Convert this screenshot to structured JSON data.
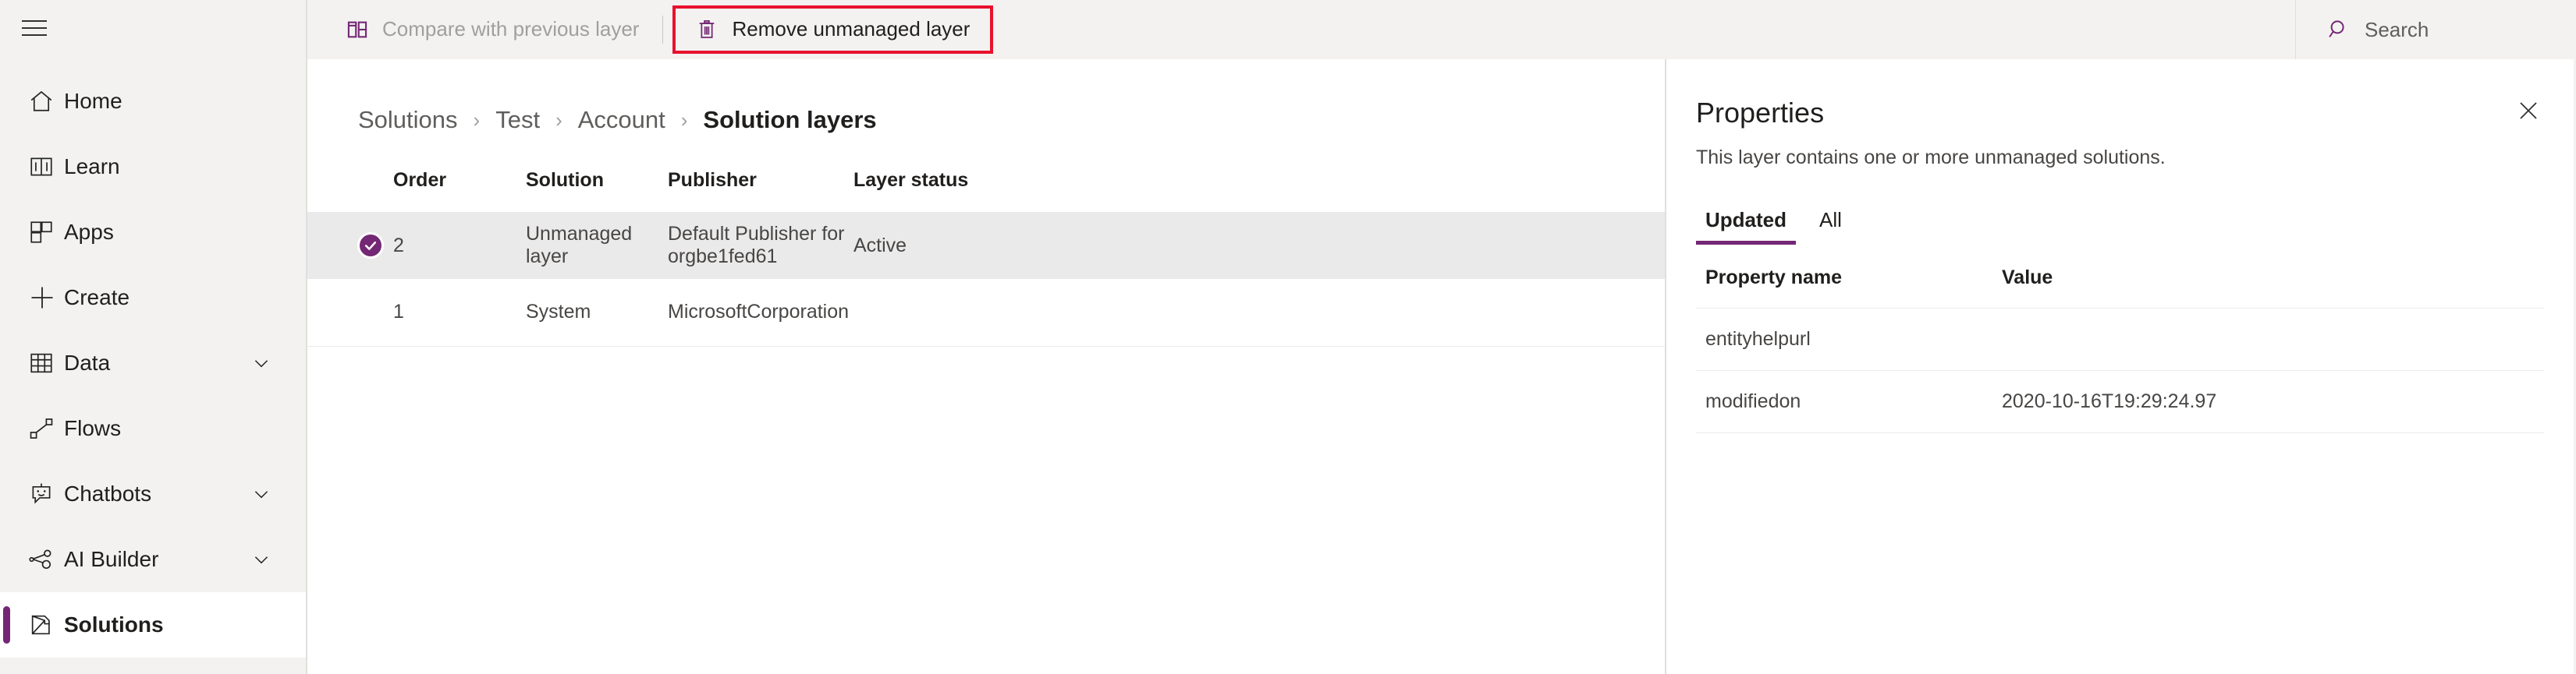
{
  "sidebar": {
    "menu_icon": "hamburger-icon",
    "items": [
      {
        "label": "Home",
        "icon": "home-icon",
        "chevron": false,
        "selected": false
      },
      {
        "label": "Learn",
        "icon": "book-icon",
        "chevron": false,
        "selected": false
      },
      {
        "label": "Apps",
        "icon": "apps-grid-icon",
        "chevron": false,
        "selected": false
      },
      {
        "label": "Create",
        "icon": "plus-icon",
        "chevron": false,
        "selected": false
      },
      {
        "label": "Data",
        "icon": "table-icon",
        "chevron": true,
        "selected": false
      },
      {
        "label": "Flows",
        "icon": "flows-icon",
        "chevron": false,
        "selected": false
      },
      {
        "label": "Chatbots",
        "icon": "chatbot-icon",
        "chevron": true,
        "selected": false
      },
      {
        "label": "AI Builder",
        "icon": "ai-builder-icon",
        "chevron": true,
        "selected": false
      },
      {
        "label": "Solutions",
        "icon": "solutions-icon",
        "chevron": false,
        "selected": true
      }
    ]
  },
  "commandbar": {
    "compare_label": "Compare with previous layer",
    "compare_icon": "compare-layers-icon",
    "compare_disabled": true,
    "remove_label": "Remove unmanaged layer",
    "remove_icon": "trash-icon",
    "remove_highlighted": true,
    "highlight_color": "#e8112d"
  },
  "search": {
    "icon": "search-icon",
    "placeholder": "Search"
  },
  "breadcrumb": {
    "items": [
      "Solutions",
      "Test",
      "Account"
    ],
    "separator": "›",
    "current": "Solution layers"
  },
  "layers_table": {
    "headers": [
      "Order",
      "Solution",
      "Publisher",
      "Layer status"
    ],
    "rows": [
      {
        "selected": true,
        "check_icon": "check-circle-icon",
        "order": "2",
        "solution": "Unmanaged layer",
        "publisher": "Default Publisher for orgbe1fed61",
        "status": "Active"
      },
      {
        "selected": false,
        "check_icon": "",
        "order": "1",
        "solution": "System",
        "publisher": "MicrosoftCorporation",
        "status": ""
      }
    ]
  },
  "properties": {
    "title": "Properties",
    "subtitle": "This layer contains one or more unmanaged solutions.",
    "close_icon": "close-icon",
    "tabs": [
      {
        "label": "Updated",
        "active": true
      },
      {
        "label": "All",
        "active": false
      }
    ],
    "headers": [
      "Property name",
      "Value"
    ],
    "rows": [
      {
        "name": "entityhelpurl",
        "value": ""
      },
      {
        "name": "modifiedon",
        "value": "2020-10-16T19:29:24.97"
      }
    ]
  },
  "colors": {
    "brand_purple": "#742774",
    "highlight_red": "#e8112d",
    "chrome_gray": "#f3f2f1",
    "row_selected": "#ebeaea"
  }
}
